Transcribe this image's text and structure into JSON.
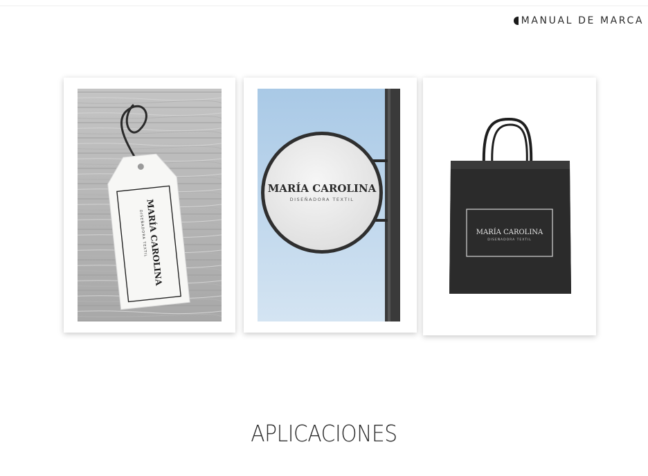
{
  "header": {
    "label": "MANUAL DE MARCA",
    "mark_icon": "half-circle-icon"
  },
  "brand": {
    "name": "MARÍA CAROLINA",
    "tagline": "DISEÑADORA TEXTIL"
  },
  "mockups": [
    {
      "id": "hang-tag",
      "description": ""
    },
    {
      "id": "shop-sign",
      "description": ""
    },
    {
      "id": "shopping-bag",
      "description": ""
    }
  ],
  "footer": {
    "title": "APLICACIONES"
  },
  "colors": {
    "bag": "#2b2b2b",
    "sky": "#bcd6ec",
    "wood": "#b9b9b9",
    "text": "#2a2a2a"
  }
}
